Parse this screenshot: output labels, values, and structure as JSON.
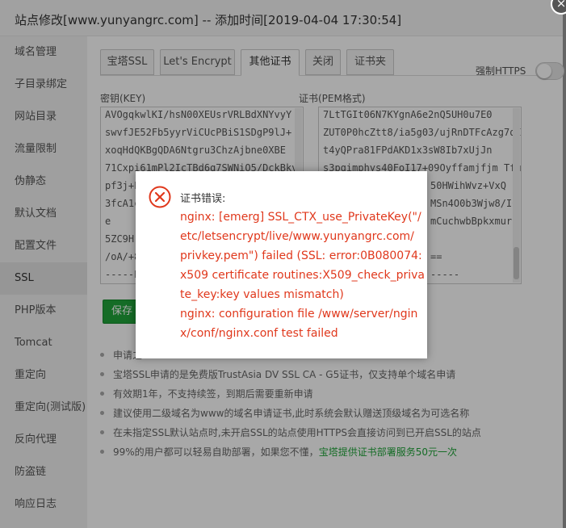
{
  "window": {
    "title": "站点修改[www.yunyangrc.com] -- 添加时间[2019-04-04 17:30:54]",
    "close_glyph": "×"
  },
  "sidebar": {
    "items": [
      {
        "label": "域名管理"
      },
      {
        "label": "子目录绑定"
      },
      {
        "label": "网站目录"
      },
      {
        "label": "流量限制"
      },
      {
        "label": "伪静态"
      },
      {
        "label": "默认文档"
      },
      {
        "label": "配置文件"
      },
      {
        "label": "SSL",
        "active": true
      },
      {
        "label": "PHP版本"
      },
      {
        "label": "Tomcat"
      },
      {
        "label": "重定向"
      },
      {
        "label": "重定向(测试版)"
      },
      {
        "label": "反向代理"
      },
      {
        "label": "防盗链"
      },
      {
        "label": "响应日志"
      }
    ]
  },
  "tabs": [
    {
      "label": "宝塔SSL"
    },
    {
      "label": "Let's Encrypt"
    },
    {
      "label": "其他证书",
      "active": true
    },
    {
      "label": "关闭"
    },
    {
      "label": "证书夹"
    }
  ],
  "https_toggle": {
    "label": "强制HTTPS",
    "on": false
  },
  "key_field": {
    "label": "密钥(KEY)",
    "lines": [
      "AVOgqkwlKI/hsN00XEUsrVRLBdXNYvyY",
      "swvfJE52Fb5yyrViCUcPBiS1SDgP9lJ+",
      "xoqHdQKBgQDA6Ntgru3ChzAjbne0XBE",
      "71Cxpi61mPl2IcTBd6q7SWNiO5/DckBkv",
      "pf3j+L",
      "3fcA1c",
      "e",
      "5ZC9H",
      "/oA/+8",
      "-----EN"
    ]
  },
  "cert_field": {
    "label": "证书(PEM格式)",
    "lines": [
      "7LtTGIt06N7KYgnA6e2nQ5UH0u7E0",
      "ZUT0P0hcZtt8/ia5g03/ujRnDTFcAzg7qI9",
      "t4yQPra81FPdAKD1x3sW8Ib7xUjJn",
      "s3pqimphys40FoI17+09Oyffamjfjm Tfu",
      "50HWihWvz+VxQ",
      "MSn4O0b3Wjw8/I0",
      "mCuchwbBpkxmur",
      "",
      "==",
      "-----"
    ]
  },
  "save_button": {
    "label": "保存"
  },
  "tips": [
    {
      "text": "申请之"
    },
    {
      "text": "宝塔SSL申请的是免费版TrustAsia DV SSL CA - G5证书，仅支持单个域名申请"
    },
    {
      "text": "有效期1年，不支持续签，到期后需要重新申请"
    },
    {
      "text": "建议使用二级域名为www的域名申请证书,此时系统会默认赠送顶级域名为可选名称"
    },
    {
      "text": "在未指定SSL默认站点时,未开启SSL的站点使用HTTPS会直接访问到已开启SSL的站点"
    },
    {
      "text": "99%的用户都可以轻易自助部署，如果您不懂，",
      "link": "宝塔提供证书部署服务50元一次"
    }
  ],
  "dialog": {
    "title": "证书错误:",
    "lines": [
      "nginx: [emerg] SSL_CTX_use_PrivateKey(\"/",
      "etc/letsencrypt/live/www.yunyangrc.com/",
      "privkey.pem\") failed (SSL: error:0B080074:",
      "x509 certificate routines:X509_check_priva",
      "te_key:key values mismatch)",
      "nginx: configuration file /www/server/ngin",
      "x/conf/nginx.conf test failed"
    ],
    "error_color": "#e0381c",
    "icon": "error-circle-x-icon"
  },
  "colors": {
    "accent_green": "#20a53a",
    "error_red": "#e0381c"
  }
}
